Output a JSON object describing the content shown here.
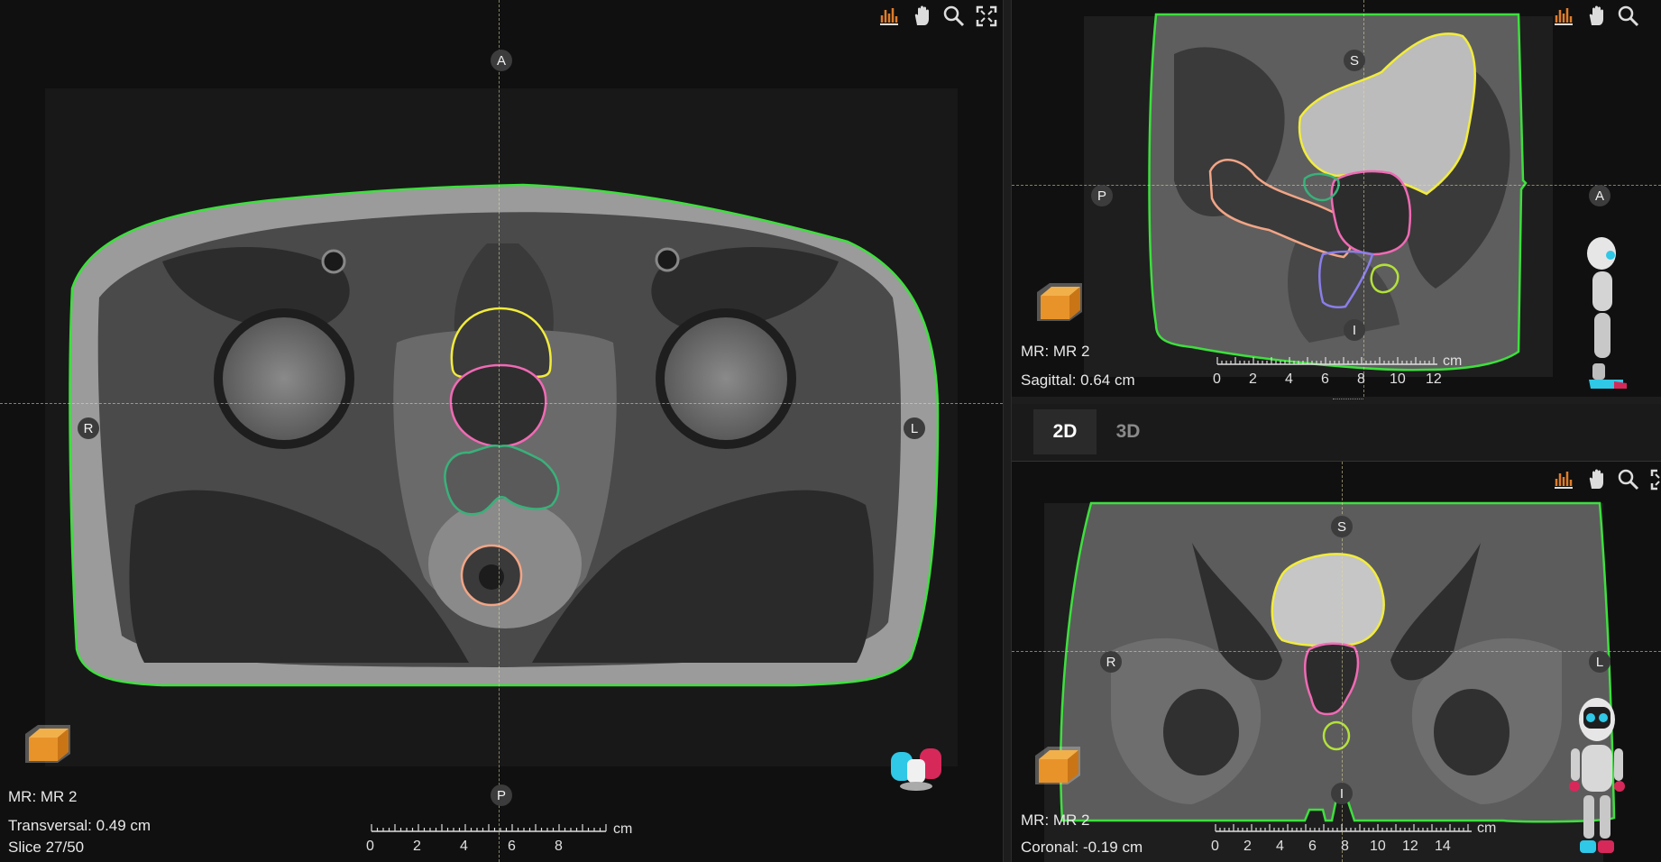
{
  "tabs": [
    {
      "label": "2D",
      "active": true
    },
    {
      "label": "3D",
      "active": false
    }
  ],
  "axial": {
    "orientation": {
      "top": "A",
      "bottom": "P",
      "left": "R",
      "right": "L"
    },
    "modality": "MR: MR 2",
    "plane_text": "Transversal: 0.49 cm",
    "slice_text": "Slice 27/50",
    "ruler": {
      "unit": "cm",
      "ticks": [
        "0",
        "2",
        "4",
        "6",
        "8"
      ]
    },
    "icons": [
      "histogram-icon",
      "hand-pan-icon",
      "zoom-icon",
      "fullscreen-icon"
    ]
  },
  "sagittal": {
    "orientation": {
      "top": "S",
      "bottom": "I",
      "left": "P",
      "right": "A"
    },
    "modality": "MR: MR 2",
    "plane_text": "Sagittal: 0.64 cm",
    "ruler": {
      "unit": "cm",
      "ticks": [
        "0",
        "2",
        "4",
        "6",
        "8",
        "10",
        "12"
      ]
    },
    "icons": [
      "histogram-icon",
      "hand-pan-icon",
      "zoom-icon"
    ]
  },
  "coronal": {
    "orientation": {
      "top": "S",
      "bottom": "I",
      "left": "R",
      "right": "L"
    },
    "modality": "MR: MR 2",
    "plane_text": "Coronal: -0.19 cm",
    "ruler": {
      "unit": "cm",
      "ticks": [
        "0",
        "2",
        "4",
        "6",
        "8",
        "10",
        "12",
        "14"
      ]
    },
    "icons": [
      "histogram-icon",
      "hand-pan-icon",
      "zoom-icon",
      "fullscreen-icon"
    ]
  },
  "colors": {
    "body_contour": "#3de03d",
    "bladder": "#f2ec3c",
    "prostate": "#f06ab4",
    "seminal_vesicles": "#39b17a",
    "rectum": "#f2a586",
    "penile_bulb": "#b3e13a",
    "purple_structure": "#8a7ee8"
  }
}
